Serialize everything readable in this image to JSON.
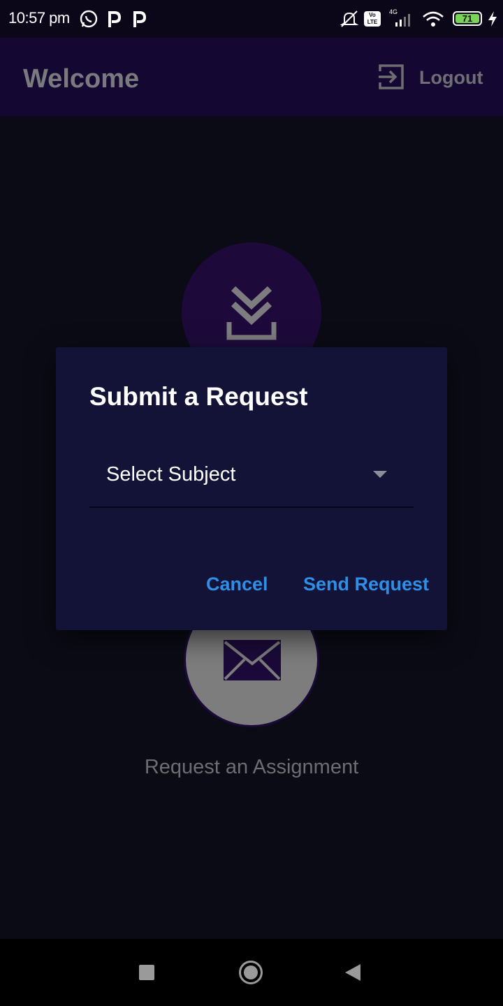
{
  "status_bar": {
    "time": "10:57 pm",
    "battery": "71",
    "network": "4G",
    "volte": "Vo LTE",
    "icons": [
      "whatsapp-icon",
      "p-app-icon",
      "p-app-icon",
      "mute-icon",
      "volte-icon",
      "signal-icon",
      "wifi-icon",
      "battery-icon",
      "charging-icon"
    ]
  },
  "app_bar": {
    "title": "Welcome",
    "logout_label": "Logout"
  },
  "tiles": {
    "download_icon": "download-icon",
    "mail_icon": "mail-icon",
    "request_label": "Request an Assignment"
  },
  "dialog": {
    "title": "Submit a Request",
    "select_value": "Select Subject",
    "cancel_label": "Cancel",
    "send_label": "Send Request"
  },
  "colors": {
    "app_bar": "#140833",
    "dialog_bg": "#121336",
    "accent": "#2f8fe6",
    "battery": "#7bd35a"
  }
}
